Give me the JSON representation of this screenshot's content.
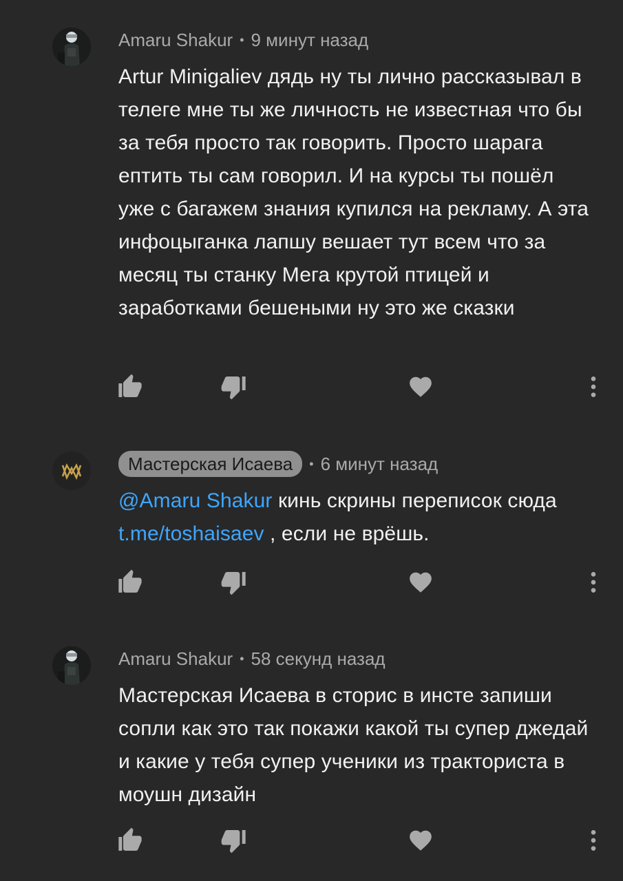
{
  "comments": [
    {
      "author": "Amaru Shakur",
      "time": "9 минут назад",
      "text": "Artur Minigaliev дядь ну ты лично рассказывал в телеге мне ты же личность не известная что бы за тебя просто так говорить. Просто шарага ептить ты сам говорил. И на курсы ты пошёл уже с багажем знания купился на рекламу. А эта инфоцыганка лапшу вешает тут всем что за месяц ты станку Мега крутой птицей и заработками бешеными ну это же сказки",
      "avatar_icon": "dark-figure-avatar"
    },
    {
      "author": "Мастерская Исаева",
      "time": "6 минут назад",
      "mention": "@Amaru Shakur",
      "text_part1": " кинь скрины переписок сюда ",
      "link": "t.me/toshaisaev",
      "text_part2": " , если не врёшь.",
      "avatar_icon": "gold-logo-avatar"
    },
    {
      "author": "Amaru Shakur",
      "time": "58 секунд назад",
      "text": "Мастерская Исаева в сторис в инсте запиши сопли как это так покажи какой ты супер джедай и какие у тебя супер ученики из тракториста в моушн дизайн",
      "avatar_icon": "dark-figure-avatar"
    }
  ],
  "icons": {
    "like": "thumbs-up-icon",
    "dislike": "thumbs-down-icon",
    "heart": "heart-icon",
    "more": "more-vert-icon"
  },
  "colors": {
    "background": "#282828",
    "text": "#f1f1f1",
    "meta": "#aaaaaa",
    "link": "#3ea6ff",
    "icon": "#aaaaaa",
    "owner_chip": "#909090",
    "logo_gold": "#c9a24b"
  }
}
